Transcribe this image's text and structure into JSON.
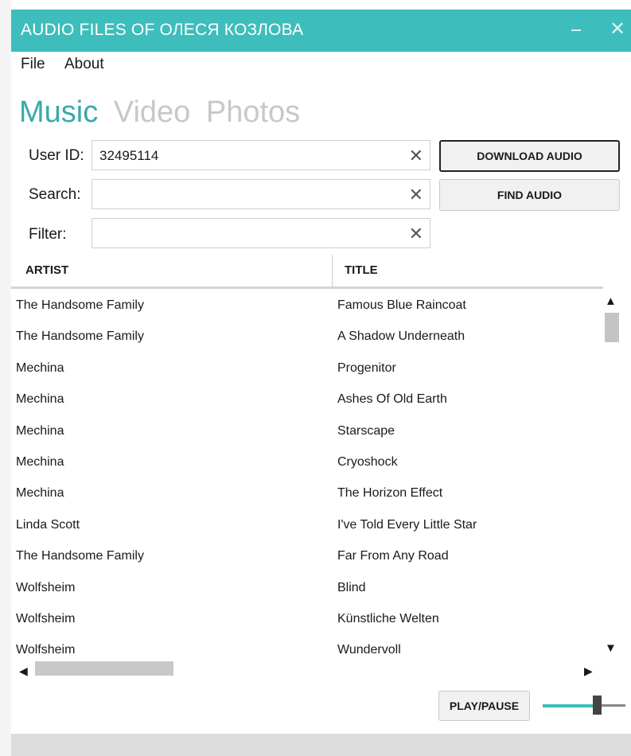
{
  "window": {
    "title": "AUDIO FILES OF ОЛЕСЯ КОЗЛОВА",
    "accent": "#3dbdbb"
  },
  "menu": {
    "items": [
      "File",
      "About"
    ]
  },
  "tabs": [
    {
      "label": "Music",
      "active": true
    },
    {
      "label": "Video",
      "active": false
    },
    {
      "label": "Photos",
      "active": false
    }
  ],
  "form": {
    "user_id_label": "User ID:",
    "user_id_value": "32495114",
    "search_label": "Search:",
    "search_value": "",
    "filter_label": "Filter:",
    "filter_value": "",
    "clear_glyph": "✕"
  },
  "buttons": {
    "download": "DOWNLOAD AUDIO",
    "find": "FIND AUDIO",
    "play_pause": "PLAY/PAUSE"
  },
  "list": {
    "columns": [
      "ARTIST",
      "TITLE"
    ],
    "rows": [
      {
        "artist": "The Handsome Family",
        "title": "Famous Blue Raincoat"
      },
      {
        "artist": "The Handsome Family",
        "title": "A Shadow Underneath"
      },
      {
        "artist": "Mechina",
        "title": "Progenitor"
      },
      {
        "artist": "Mechina",
        "title": "Ashes Of Old Earth"
      },
      {
        "artist": "Mechina",
        "title": "Starscape"
      },
      {
        "artist": "Mechina",
        "title": "Cryoshock"
      },
      {
        "artist": "Mechina",
        "title": "The Horizon Effect"
      },
      {
        "artist": "Linda Scott",
        "title": "I've Told Every Little Star"
      },
      {
        "artist": "The Handsome Family",
        "title": "Far From Any Road"
      },
      {
        "artist": "Wolfsheim",
        "title": "Blind"
      },
      {
        "artist": "Wolfsheim",
        "title": "Künstliche Welten"
      },
      {
        "artist": "Wolfsheim",
        "title": "Wundervoll"
      }
    ]
  },
  "volume": {
    "level": 0.65
  }
}
